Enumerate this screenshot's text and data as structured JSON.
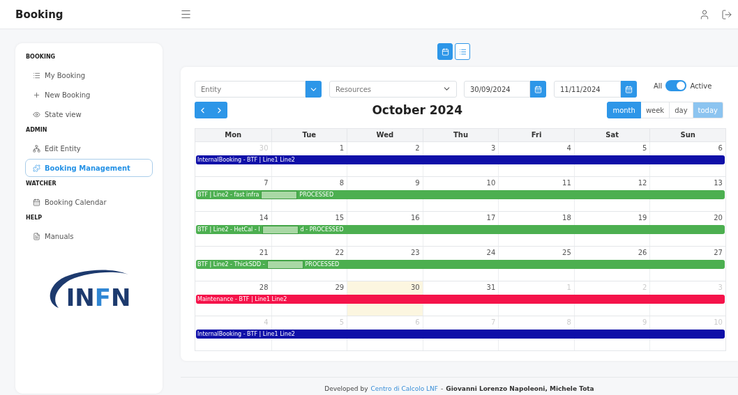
{
  "header": {
    "title": "Booking"
  },
  "sidebar": {
    "groups": [
      {
        "title": "BOOKING",
        "items": [
          {
            "label": "My Booking",
            "selected": false
          },
          {
            "label": "New Booking",
            "selected": false
          },
          {
            "label": "State view",
            "selected": false
          }
        ]
      },
      {
        "title": "ADMIN",
        "items": [
          {
            "label": "Edit Entity",
            "selected": false
          },
          {
            "label": "Booking Management",
            "selected": true
          }
        ]
      },
      {
        "title": "WATCHER",
        "items": [
          {
            "label": "Booking Calendar",
            "selected": false
          }
        ]
      },
      {
        "title": "HELP",
        "items": [
          {
            "label": "Manuals",
            "selected": false
          }
        ]
      }
    ],
    "logo_text": "INFN"
  },
  "view_switch": [
    {
      "kind": "calendar",
      "selected": true
    },
    {
      "kind": "list",
      "selected": false
    }
  ],
  "filters": {
    "entity": {
      "placeholder": "Entity"
    },
    "resources": {
      "placeholder": "Resources"
    },
    "date_from": "30/09/2024",
    "date_to": "11/11/2024",
    "toggle": {
      "left_label": "All",
      "right_label": "Active",
      "on": true
    }
  },
  "calendar": {
    "title": "October 2024",
    "views": [
      {
        "label": "month",
        "selected": true
      },
      {
        "label": "week",
        "selected": false
      },
      {
        "label": "day",
        "selected": false
      },
      {
        "label": "today",
        "selected": false
      }
    ],
    "columns": [
      "Mon",
      "Tue",
      "Wed",
      "Thu",
      "Fri",
      "Sat",
      "Sun"
    ],
    "weeks": [
      {
        "days": [
          {
            "label": "30",
            "other_month": true,
            "today": false
          },
          {
            "label": "1",
            "other_month": false,
            "today": false
          },
          {
            "label": "2",
            "other_month": false,
            "today": false
          },
          {
            "label": "3",
            "other_month": false,
            "today": false
          },
          {
            "label": "4",
            "other_month": false,
            "today": false
          },
          {
            "label": "5",
            "other_month": false,
            "today": false
          },
          {
            "label": "6",
            "other_month": false,
            "today": false
          }
        ],
        "event": {
          "text": "InternalBooking - BTF | Line1 Line2",
          "redacted": false,
          "color": "#0f0fa8"
        }
      },
      {
        "days": [
          {
            "label": "7",
            "other_month": false,
            "today": false
          },
          {
            "label": "8",
            "other_month": false,
            "today": false
          },
          {
            "label": "9",
            "other_month": false,
            "today": false
          },
          {
            "label": "10",
            "other_month": false,
            "today": false
          },
          {
            "label": "11",
            "other_month": false,
            "today": false
          },
          {
            "label": "12",
            "other_month": false,
            "today": false
          },
          {
            "label": "13",
            "other_month": false,
            "today": false
          }
        ],
        "event": {
          "text": "BTF | Line2 - fast infra",
          "redacted": true,
          "suffix": "PROCESSED",
          "color": "#4caf50"
        }
      },
      {
        "days": [
          {
            "label": "14",
            "other_month": false,
            "today": false
          },
          {
            "label": "15",
            "other_month": false,
            "today": false
          },
          {
            "label": "16",
            "other_month": false,
            "today": false
          },
          {
            "label": "17",
            "other_month": false,
            "today": false
          },
          {
            "label": "18",
            "other_month": false,
            "today": false
          },
          {
            "label": "19",
            "other_month": false,
            "today": false
          },
          {
            "label": "20",
            "other_month": false,
            "today": false
          }
        ],
        "event": {
          "text": "BTF | Line2 - HetCal - I",
          "redacted": true,
          "suffix": "d - PROCESSED",
          "color": "#4caf50"
        }
      },
      {
        "days": [
          {
            "label": "21",
            "other_month": false,
            "today": false
          },
          {
            "label": "22",
            "other_month": false,
            "today": false
          },
          {
            "label": "23",
            "other_month": false,
            "today": false
          },
          {
            "label": "24",
            "other_month": false,
            "today": false
          },
          {
            "label": "25",
            "other_month": false,
            "today": false
          },
          {
            "label": "26",
            "other_month": false,
            "today": false
          },
          {
            "label": "27",
            "other_month": false,
            "today": false
          }
        ],
        "event": {
          "text": "BTF | Line2 - ThickSDD -",
          "redacted": true,
          "suffix": "PROCESSED",
          "color": "#4caf50"
        }
      },
      {
        "days": [
          {
            "label": "28",
            "other_month": false,
            "today": false
          },
          {
            "label": "29",
            "other_month": false,
            "today": false
          },
          {
            "label": "30",
            "other_month": false,
            "today": true
          },
          {
            "label": "31",
            "other_month": false,
            "today": false
          },
          {
            "label": "1",
            "other_month": true,
            "today": false
          },
          {
            "label": "2",
            "other_month": true,
            "today": false
          },
          {
            "label": "3",
            "other_month": true,
            "today": false
          }
        ],
        "event": {
          "text": "Maintenance - BTF | Line1 Line2",
          "redacted": false,
          "color": "#f5134a"
        }
      },
      {
        "days": [
          {
            "label": "4",
            "other_month": true,
            "today": false
          },
          {
            "label": "5",
            "other_month": true,
            "today": false
          },
          {
            "label": "6",
            "other_month": true,
            "today": false
          },
          {
            "label": "7",
            "other_month": true,
            "today": false
          },
          {
            "label": "8",
            "other_month": true,
            "today": false
          },
          {
            "label": "9",
            "other_month": true,
            "today": false
          },
          {
            "label": "10",
            "other_month": true,
            "today": false
          }
        ],
        "event": {
          "text": "InternalBooking - BTF | Line1 Line2",
          "redacted": false,
          "color": "#0f0fa8"
        }
      }
    ]
  },
  "footer": {
    "prefix": "Developed by",
    "link": "Centro di Calcolo LNF",
    "separator": "-",
    "authors": "Giovanni Lorenzo Napoleoni, Michele Tota"
  }
}
